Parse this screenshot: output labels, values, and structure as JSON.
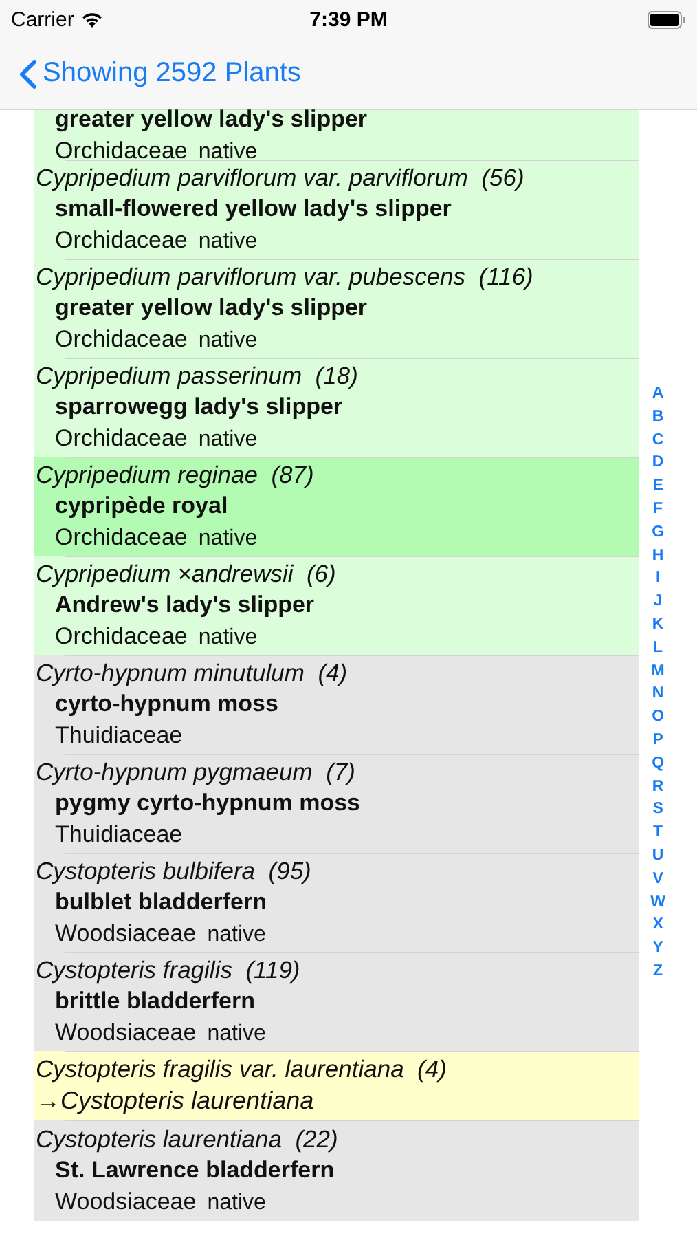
{
  "status_bar": {
    "carrier": "Carrier",
    "time": "7:39 PM"
  },
  "nav": {
    "back_label": "Showing 2592 Plants"
  },
  "rows": [
    {
      "kind": "plant",
      "highlighted": true,
      "selected": false,
      "common": "greater yellow lady's slipper",
      "family": "Orchidaceae",
      "status": "native"
    },
    {
      "kind": "plant",
      "highlighted": true,
      "selected": false,
      "scientific": "Cypripedium parviflorum var. parviflorum",
      "count": "(56)",
      "common": "small-flowered yellow lady's slipper",
      "family": "Orchidaceae",
      "status": "native"
    },
    {
      "kind": "plant",
      "highlighted": true,
      "selected": false,
      "scientific": "Cypripedium parviflorum var. pubescens",
      "count": "(116)",
      "common": "greater yellow lady's slipper",
      "family": "Orchidaceae",
      "status": "native"
    },
    {
      "kind": "plant",
      "highlighted": true,
      "selected": false,
      "scientific": "Cypripedium passerinum",
      "count": "(18)",
      "common": "sparrowegg lady's slipper",
      "family": "Orchidaceae",
      "status": "native"
    },
    {
      "kind": "plant",
      "highlighted": true,
      "selected": true,
      "scientific": "Cypripedium reginae",
      "count": "(87)",
      "common": "cypripède royal",
      "family": "Orchidaceae",
      "status": "native"
    },
    {
      "kind": "plant",
      "highlighted": true,
      "selected": false,
      "scientific": "Cypripedium ×andrewsii",
      "count": "(6)",
      "common": "Andrew's lady's slipper",
      "family": "Orchidaceae",
      "status": "native"
    },
    {
      "kind": "plant",
      "highlighted": false,
      "selected": false,
      "scientific": "Cyrto-hypnum minutulum",
      "count": "(4)",
      "common": "cyrto-hypnum moss",
      "family": "Thuidiaceae"
    },
    {
      "kind": "plant",
      "highlighted": false,
      "selected": false,
      "scientific": "Cyrto-hypnum pygmaeum",
      "count": "(7)",
      "common": "pygmy cyrto-hypnum moss",
      "family": "Thuidiaceae"
    },
    {
      "kind": "plant",
      "highlighted": false,
      "selected": false,
      "scientific": "Cystopteris bulbifera",
      "count": "(95)",
      "common": "bulblet bladderfern",
      "family": "Woodsiaceae",
      "status": "native"
    },
    {
      "kind": "plant",
      "highlighted": false,
      "selected": false,
      "scientific": "Cystopteris fragilis",
      "count": "(119)",
      "common": "brittle bladderfern",
      "family": "Woodsiaceae",
      "status": "native"
    },
    {
      "kind": "synonym",
      "highlighted": false,
      "selected": false,
      "scientific": "Cystopteris fragilis var. laurentiana",
      "count": "(4)",
      "target": "→Cystopteris laurentiana"
    },
    {
      "kind": "plant",
      "highlighted": false,
      "selected": false,
      "scientific": "Cystopteris laurentiana",
      "count": "(22)",
      "common": "St. Lawrence bladderfern",
      "family": "Woodsiaceae",
      "status": "native"
    }
  ],
  "index": [
    "A",
    "B",
    "C",
    "D",
    "E",
    "F",
    "G",
    "H",
    "I",
    "J",
    "K",
    "L",
    "M",
    "N",
    "O",
    "P",
    "Q",
    "R",
    "S",
    "T",
    "U",
    "V",
    "W",
    "X",
    "Y",
    "Z"
  ]
}
